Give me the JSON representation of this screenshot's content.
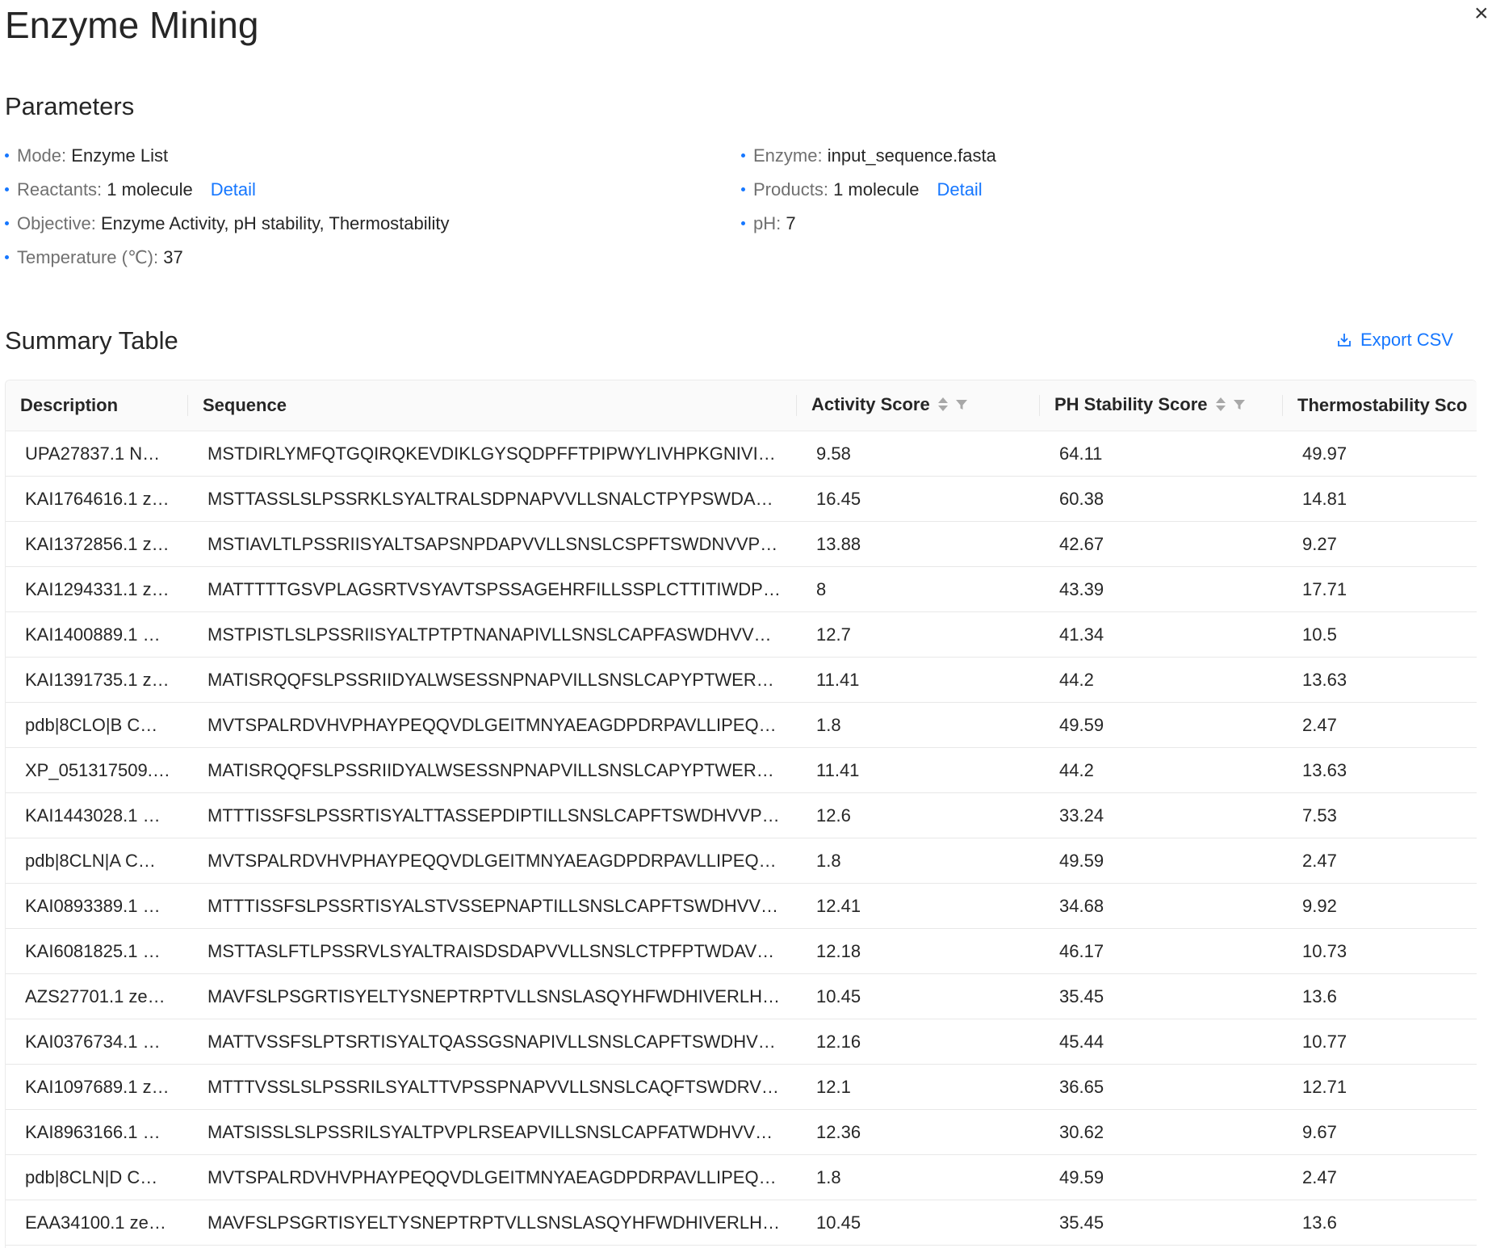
{
  "title": "Enzyme Mining",
  "parameters": {
    "heading": "Parameters",
    "left": [
      {
        "label": "Mode:",
        "value": "Enzyme List",
        "link": ""
      },
      {
        "label": "Reactants:",
        "value": "1 molecule",
        "link": "Detail"
      },
      {
        "label": "Objective:",
        "value": "Enzyme Activity, pH stability, Thermostability",
        "link": ""
      },
      {
        "label": "Temperature (℃):",
        "value": "37",
        "link": ""
      }
    ],
    "right": [
      {
        "label": "Enzyme:",
        "value": "input_sequence.fasta",
        "link": ""
      },
      {
        "label": "Products:",
        "value": "1 molecule",
        "link": "Detail"
      },
      {
        "label": "pH:",
        "value": "7",
        "link": ""
      }
    ]
  },
  "summary": {
    "heading": "Summary Table",
    "export_label": "Export CSV",
    "columns": [
      "Description",
      "Sequence",
      "Activity Score",
      "PH Stability Score",
      "Thermostability Sco"
    ],
    "rows": [
      [
        "UPA27837.1 N…",
        "MSTDIRLYMFQTGQIRQKEVDIKLGYSQDPFFTPIPWYLIVHPKGNIVI…",
        "9.58",
        "64.11",
        "49.97"
      ],
      [
        "KAI1764616.1 z…",
        "MSTTASSLSLPSSRKLSYALTRALSDPNAPVVLLSNALCTPYPSWDA…",
        "16.45",
        "60.38",
        "14.81"
      ],
      [
        "KAI1372856.1 z…",
        "MSTIAVLTLPSSRIISYALTSAPSNPDAPVVLLSNSLCSPFTSWDNVVP…",
        "13.88",
        "42.67",
        "9.27"
      ],
      [
        "KAI1294331.1 z…",
        "MATTTTTGSVPLAGSRTVSYAVTSPSSAGEHRFILLSSPLCTTITIWDP…",
        "8",
        "43.39",
        "17.71"
      ],
      [
        "KAI1400889.1 …",
        "MSTPISTLSLPSSRIISYALTPTPTNANAPIVLLSNSLCAPFASWDHVV…",
        "12.7",
        "41.34",
        "10.5"
      ],
      [
        "KAI1391735.1 z…",
        "MATISRQQFSLPSSRIIDYALWSESSNPNAPVILLSNSLCAPYPTWER…",
        "11.41",
        "44.2",
        "13.63"
      ],
      [
        "pdb|8CLO|B C…",
        "MVTSPALRDVHVPHAYPEQQVDLGEITMNYAEAGDPDRPAVLLIPEQ…",
        "1.8",
        "49.59",
        "2.47"
      ],
      [
        "XP_051317509.…",
        "MATISRQQFSLPSSRIIDYALWSESSNPNAPVILLSNSLCAPYPTWER…",
        "11.41",
        "44.2",
        "13.63"
      ],
      [
        "KAI1443028.1 …",
        "MTTTISSFSLPSSRTISYALTTASSEPDIPTILLSNSLCAPFTSWDHVVP…",
        "12.6",
        "33.24",
        "7.53"
      ],
      [
        "pdb|8CLN|A C…",
        "MVTSPALRDVHVPHAYPEQQVDLGEITMNYAEAGDPDRPAVLLIPEQ…",
        "1.8",
        "49.59",
        "2.47"
      ],
      [
        "KAI0893389.1 …",
        "MTTTISSFSLPSSRTISYALSTVSSEPNAPTILLSNSLCAPFTSWDHVV…",
        "12.41",
        "34.68",
        "9.92"
      ],
      [
        "KAI6081825.1 …",
        "MSTTASLFTLPSSRVLSYALTRAISDSDAPVVLLSNSLCTPFPTWDAV…",
        "12.18",
        "46.17",
        "10.73"
      ],
      [
        "AZS27701.1 ze…",
        "MAVFSLPSGRTISYELTYSNEPTRPTVLLSNSLASQYHFWDHIVERLH…",
        "10.45",
        "35.45",
        "13.6"
      ],
      [
        "KAI0376734.1 …",
        "MATTVSSFSLPTSRTISYALTQASSGSNAPIVLLSNSLCAPFTSWDHV…",
        "12.16",
        "45.44",
        "10.77"
      ],
      [
        "KAI1097689.1 z…",
        "MTTTVSSLSLPSSRILSYALTTVPSSPNAPVVLLSNSLCAQFTSWDRV…",
        "12.1",
        "36.65",
        "12.71"
      ],
      [
        "KAI8963166.1 …",
        "MATSISSLSLPSSRILSYALTPVPLRSEAPVILLSNSLCAPFATWDHVV…",
        "12.36",
        "30.62",
        "9.67"
      ],
      [
        "pdb|8CLN|D C…",
        "MVTSPALRDVHVPHAYPEQQVDLGEITMNYAEAGDPDRPAVLLIPEQ…",
        "1.8",
        "49.59",
        "2.47"
      ],
      [
        "EAA34100.1 ze…",
        "MAVFSLPSGRTISYELTYSNEPTRPTVLLSNSLASQYHFWDHIVERLH…",
        "10.45",
        "35.45",
        "13.6"
      ]
    ]
  },
  "colors": {
    "accent": "#1677ff",
    "header_bg": "#fafafa",
    "border": "#e8e8e8"
  },
  "icons": {
    "close": "close-icon",
    "export": "download-icon",
    "sort": "sort-icon",
    "filter": "filter-icon"
  }
}
